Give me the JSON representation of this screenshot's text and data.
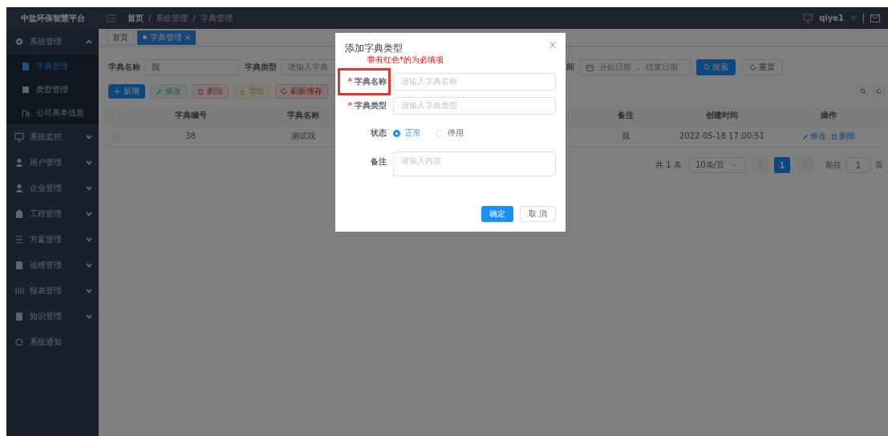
{
  "sidebar": {
    "title": "中盐环保智慧平台",
    "items": [
      {
        "label": "系统管理",
        "kind": "group",
        "expanded": true,
        "children": [
          {
            "label": "字典管理",
            "selected": true
          },
          {
            "label": "类型管理",
            "selected": false
          },
          {
            "label": "公司基本信息",
            "selected": false
          }
        ]
      },
      {
        "label": "系统监控",
        "kind": "group",
        "expanded": false
      },
      {
        "label": "用户管理",
        "kind": "group",
        "expanded": false
      },
      {
        "label": "企业管理",
        "kind": "group",
        "expanded": false
      },
      {
        "label": "工程管理",
        "kind": "group",
        "expanded": false
      },
      {
        "label": "方案管理",
        "kind": "group",
        "expanded": false
      },
      {
        "label": "运维管理",
        "kind": "group",
        "expanded": false
      },
      {
        "label": "报表管理",
        "kind": "group",
        "expanded": false
      },
      {
        "label": "知识管理",
        "kind": "group",
        "expanded": false
      },
      {
        "label": "系统通知",
        "kind": "link"
      }
    ]
  },
  "header": {
    "breadcrumb": [
      "首页",
      "系统管理",
      "字典管理"
    ],
    "separator": "/",
    "user": "qiye1"
  },
  "tabs": [
    {
      "label": "首页",
      "selected": false,
      "closable": false
    },
    {
      "label": "字典管理",
      "selected": true,
      "closable": true
    }
  ],
  "filters": {
    "name_label": "字典名称",
    "name_value": "我",
    "type_label": "字典类型",
    "type_placeholder": "请输入字典",
    "time_label": "间",
    "start_placeholder": "开始日期",
    "range_separator": "-",
    "end_placeholder": "结束日期",
    "search_button": "搜索",
    "reset_button": "重置"
  },
  "toolbar": [
    {
      "label": "新增",
      "kind": "primary",
      "disabled": false
    },
    {
      "label": "修改",
      "kind": "success",
      "disabled": true
    },
    {
      "label": "删除",
      "kind": "danger",
      "disabled": true
    },
    {
      "label": "导出",
      "kind": "warning",
      "disabled": true
    },
    {
      "label": "刷新缓存",
      "kind": "danger",
      "disabled": false
    }
  ],
  "table": {
    "all_selected": false,
    "columns": [
      "字典编号",
      "字典名称",
      "备注",
      "创建时间",
      "操作"
    ],
    "rows": [
      {
        "selected": false,
        "cells": [
          "38",
          "测试我",
          "我",
          "2022-05-18 17:00:51"
        ],
        "actions": [
          "修改",
          "删除"
        ]
      }
    ]
  },
  "pagination": {
    "total": "共 1 条",
    "page_size": "10条/页",
    "pages": [
      {
        "label": "1",
        "selected": true
      }
    ],
    "goto_label": "前往",
    "goto_value": "1",
    "page_suffix": "页"
  },
  "dialog": {
    "title": "添加字典类型",
    "hint": "带有红色*的为必填项",
    "required_mark": "*",
    "fields": [
      {
        "kind": "input",
        "label": "字典名称",
        "required": true,
        "highlighted": true,
        "placeholder": "请输入字典名称"
      },
      {
        "kind": "input",
        "label": "字典类型",
        "required": true,
        "highlighted": false,
        "placeholder": "请输入字典类型"
      },
      {
        "kind": "radio",
        "label": "状态",
        "required": false,
        "highlighted": false,
        "options": [
          {
            "label": "正常",
            "selected": true
          },
          {
            "label": "停用",
            "selected": false
          }
        ]
      },
      {
        "kind": "textarea",
        "label": "备注",
        "required": false,
        "highlighted": false,
        "placeholder": "请输入内容"
      }
    ],
    "buttons": [
      {
        "label": "确定",
        "kind": "primary"
      },
      {
        "label": "取 消",
        "kind": "default"
      }
    ]
  }
}
